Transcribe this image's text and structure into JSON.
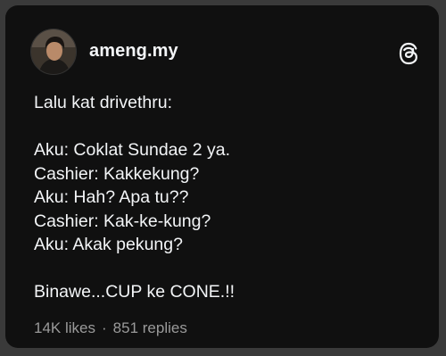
{
  "post": {
    "username": "ameng.my",
    "lines": [
      "Lalu kat drivethru:",
      "",
      "Aku: Coklat Sundae 2 ya.",
      "Cashier: Kakkekung?",
      "Aku: Hah? Apa tu??",
      "Cashier: Kak-ke-kung?",
      "Aku: Akak pekung?",
      "",
      "Binawe...CUP ke CONE.!!"
    ],
    "likes": "14K likes",
    "separator": "·",
    "replies": "851 replies"
  },
  "icons": {
    "avatar": "profile-photo",
    "logo": "threads-logo-icon"
  },
  "colors": {
    "card_background": "#101010",
    "text": "#f3f5f7",
    "muted_text": "#9a9a9a"
  }
}
